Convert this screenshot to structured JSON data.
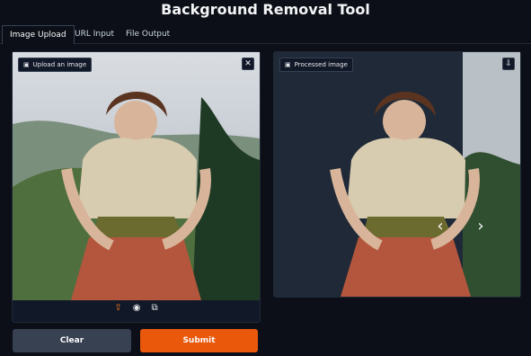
{
  "app": {
    "title": "Background Removal Tool"
  },
  "tabs": [
    {
      "label": "Image Upload"
    },
    {
      "label": "URL Input"
    },
    {
      "label": "File Output"
    }
  ],
  "left_panel": {
    "label": "Upload an image",
    "close_icon": "close-icon",
    "source_icons": [
      "upload-icon",
      "webcam-icon",
      "clipboard-icon"
    ]
  },
  "right_panel": {
    "label": "Processed image",
    "download_icon": "download-icon"
  },
  "buttons": {
    "clear": "Clear",
    "submit": "Submit"
  },
  "colors": {
    "background": "#0c0f17",
    "panel": "#111827",
    "accent": "#ea580c",
    "muted_button": "#374151"
  }
}
